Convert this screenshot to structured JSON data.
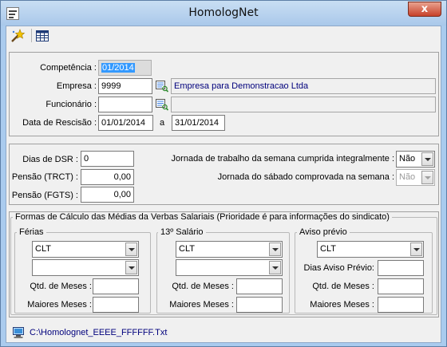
{
  "window": {
    "title": "HomologNet",
    "close_symbol": "x"
  },
  "toolbar": {
    "items": [
      {
        "icon": "wand-icon"
      },
      {
        "icon": "grid-icon"
      }
    ]
  },
  "header": {
    "competencia": {
      "label": "Competência :",
      "value": "01/2014"
    },
    "empresa": {
      "label": "Empresa :",
      "value": "9999",
      "name": "Empresa para Demonstracao Ltda"
    },
    "funcionario": {
      "label": "Funcionário :",
      "value": "",
      "name": ""
    },
    "rescisao": {
      "label": "Data de Rescisão :",
      "start": "01/01/2014",
      "sep": "a",
      "end": "31/01/2014"
    }
  },
  "middle": {
    "dsr": {
      "label": "Dias de DSR :",
      "value": "0"
    },
    "pensao_trct": {
      "label": "Pensão (TRCT) :",
      "value": "0,00"
    },
    "pensao_fgts": {
      "label": "Pensão (FGTS) :",
      "value": "0,00"
    },
    "jornada_semana": {
      "label": "Jornada de trabalho da semana cumprida integralmente :",
      "value": "Não"
    },
    "jornada_sabado": {
      "label": "Jornada do sábado comprovada na semana :",
      "value": "Não"
    }
  },
  "calculo": {
    "title": "Formas de Cálculo das Médias da Verbas Salariais  (Prioridade é para informações do sindicato)",
    "ferias": {
      "title": "Férias",
      "combo1": "CLT",
      "combo2": "",
      "qtd_label": "Qtd. de Meses :",
      "qtd_value": "",
      "maiores_label": "Maiores Meses :",
      "maiores_value": ""
    },
    "decimo": {
      "title": "13º Salário",
      "combo1": "CLT",
      "combo2": "",
      "qtd_label": "Qtd. de Meses :",
      "qtd_value": "",
      "maiores_label": "Maiores Meses :",
      "maiores_value": ""
    },
    "aviso": {
      "title": "Aviso prévio",
      "combo1": "CLT",
      "dias_label": "Dias Aviso Prévio:",
      "dias_value": "",
      "qtd_label": "Qtd. de Meses :",
      "qtd_value": "",
      "maiores_label": "Maiores Meses :",
      "maiores_value": ""
    }
  },
  "status": {
    "icon": "computer-icon",
    "path": "C:\\Homolognet_EEEE_FFFFFF.Txt"
  }
}
